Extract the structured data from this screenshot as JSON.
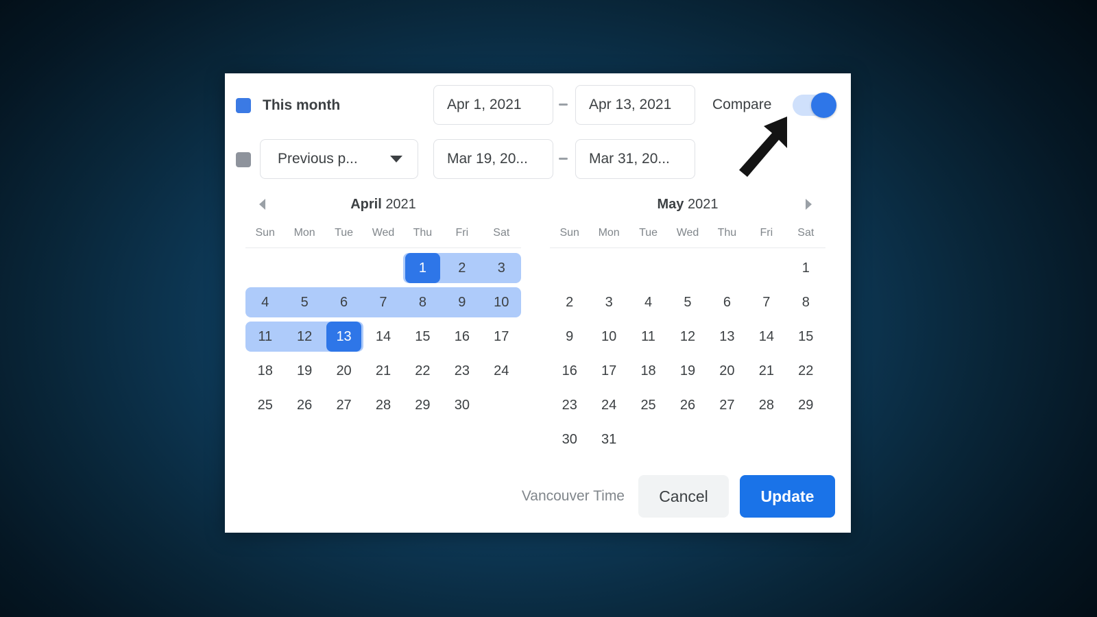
{
  "dialog": {
    "primary_row": {
      "swatch_color": "#3b7ae4",
      "preset_label": "This month",
      "start_date": "Apr 1, 2021",
      "end_date": "Apr 13, 2021",
      "separator": "-"
    },
    "compare_row": {
      "swatch_color": "#8e939c",
      "preset_label": "Previous p...",
      "dropdown_icon": "chevron-down-icon",
      "start_date": "Mar 19, 20...",
      "end_date": "Mar 31, 20...",
      "separator": "-"
    },
    "compare": {
      "label": "Compare",
      "enabled": true,
      "accent_color": "#2e76e8",
      "track_color": "#cfe0fb"
    },
    "calendars": [
      {
        "month": "April",
        "year": "2021",
        "nav_icon": "chevron-left-icon",
        "weekdays": [
          "Sun",
          "Mon",
          "Tue",
          "Wed",
          "Thu",
          "Fri",
          "Sat"
        ],
        "leading_blanks": 4,
        "days": [
          1,
          2,
          3,
          4,
          5,
          6,
          7,
          8,
          9,
          10,
          11,
          12,
          13,
          14,
          15,
          16,
          17,
          18,
          19,
          20,
          21,
          22,
          23,
          24,
          25,
          26,
          27,
          28,
          29,
          30
        ],
        "selected_days": [
          1,
          13
        ],
        "range_days": [
          1,
          2,
          3,
          4,
          5,
          6,
          7,
          8,
          9,
          10,
          11,
          12,
          13
        ]
      },
      {
        "month": "May",
        "year": "2021",
        "nav_icon": "chevron-right-icon",
        "weekdays": [
          "Sun",
          "Mon",
          "Tue",
          "Wed",
          "Thu",
          "Fri",
          "Sat"
        ],
        "leading_blanks": 6,
        "days": [
          1,
          2,
          3,
          4,
          5,
          6,
          7,
          8,
          9,
          10,
          11,
          12,
          13,
          14,
          15,
          16,
          17,
          18,
          19,
          20,
          21,
          22,
          23,
          24,
          25,
          26,
          27,
          28,
          29,
          30,
          31
        ],
        "selected_days": [],
        "range_days": []
      }
    ],
    "footer": {
      "timezone_label": "Vancouver Time",
      "cancel_label": "Cancel",
      "update_label": "Update",
      "update_color": "#1a73e8"
    }
  },
  "cursor": {
    "icon": "arrow-pointer-icon",
    "color": "#141414"
  }
}
